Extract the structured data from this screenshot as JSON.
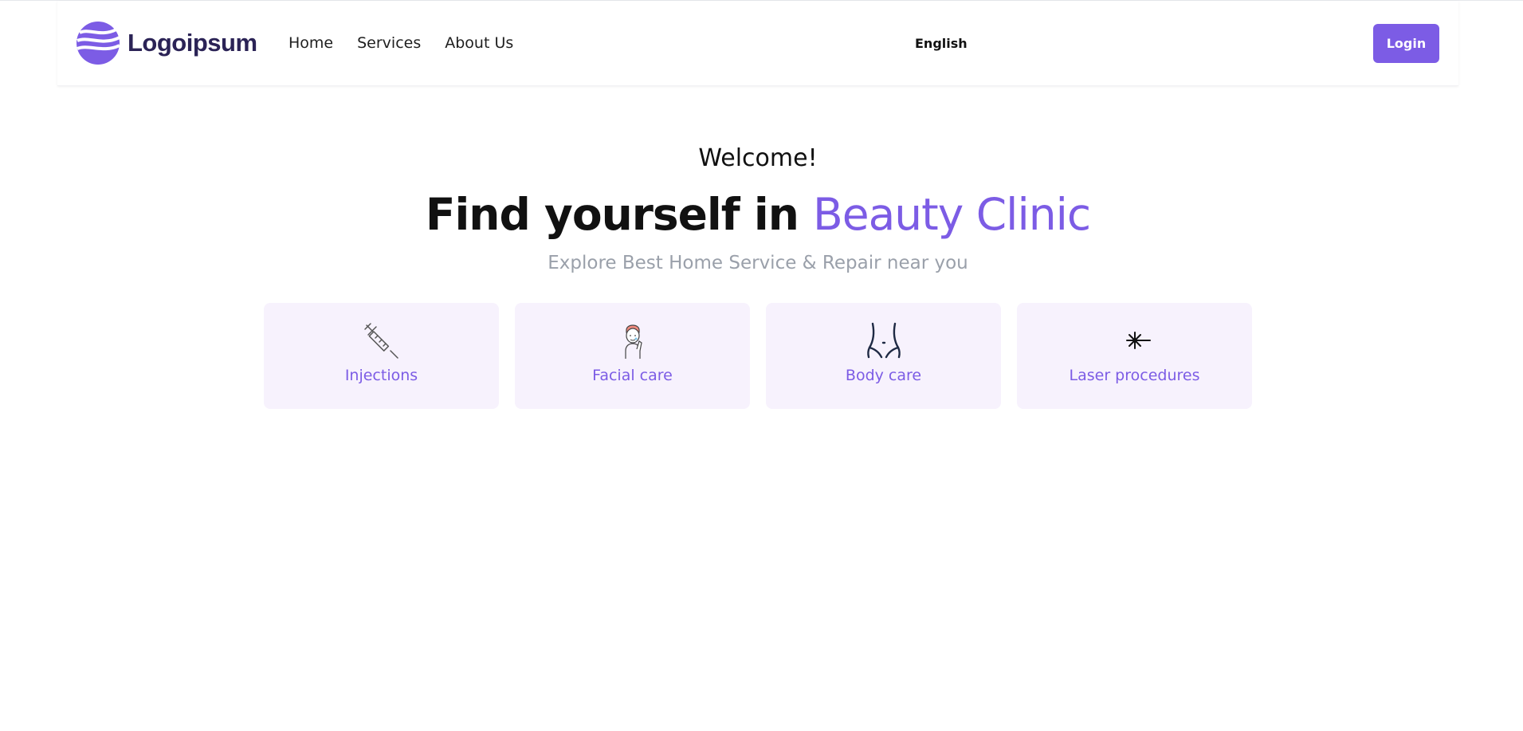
{
  "header": {
    "logo_text": "Logoipsum",
    "nav": [
      {
        "label": "Home"
      },
      {
        "label": "Services"
      },
      {
        "label": "About Us"
      }
    ],
    "language": "English",
    "login_label": "Login"
  },
  "hero": {
    "welcome": "Welcome!",
    "headline_prefix": "Find yourself in",
    "headline_accent": "Beauty Clinic",
    "subtitle": "Explore Best Home Service & Repair near you"
  },
  "categories": [
    {
      "label": "Injections",
      "icon": "syringe-icon"
    },
    {
      "label": "Facial care",
      "icon": "face-icon"
    },
    {
      "label": "Body care",
      "icon": "body-icon"
    },
    {
      "label": "Laser procedures",
      "icon": "laser-icon"
    }
  ],
  "colors": {
    "accent": "#7c5ce5",
    "card_background": "#f7f2fd",
    "subtitle": "#9aa0aa",
    "logo_text": "#2b2356"
  }
}
